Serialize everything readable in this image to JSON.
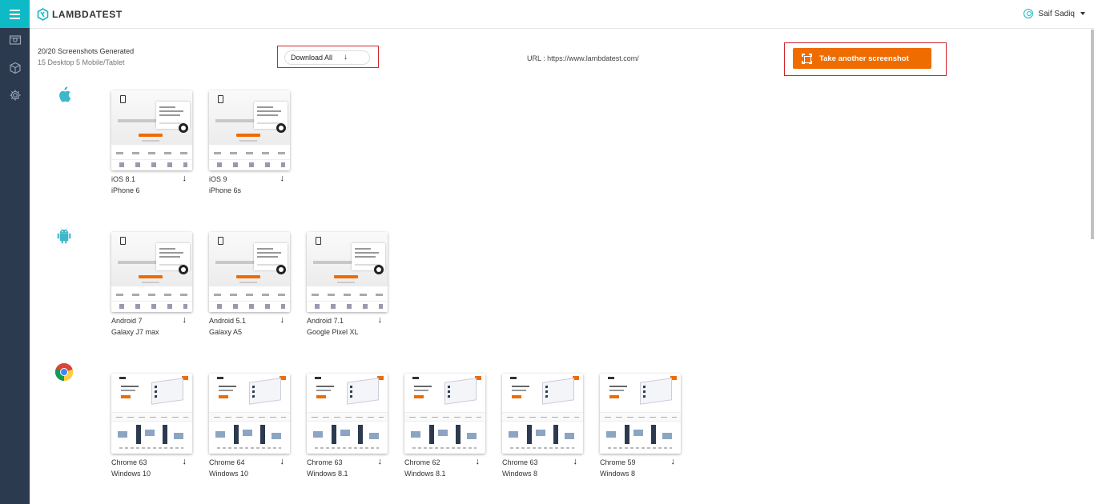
{
  "app": {
    "brand": "LAMBDATEST",
    "user_name": "Saif Sadiq"
  },
  "sidebar": {
    "items": [
      {
        "name": "menu",
        "icon": "menu-icon"
      },
      {
        "name": "screenshots",
        "icon": "screenshot-icon"
      },
      {
        "name": "box",
        "icon": "box-icon"
      },
      {
        "name": "settings",
        "icon": "gear-icon"
      }
    ]
  },
  "toolbar": {
    "generated": "20/20 Screenshots Generated",
    "breakdown": "15 Desktop 5 Mobile/Tablet",
    "download_all": "Download All",
    "download_arrow": "↓",
    "url": "URL : https://www.lambdatest.com/",
    "take_another": "Take another screenshot"
  },
  "colors": {
    "accent": "#0ebac5",
    "sidebar": "#2b3a4e",
    "cta": "#ef6c00",
    "highlight": "#d0262d"
  },
  "groups": [
    {
      "os": "ios",
      "icon": "apple-icon",
      "shots": [
        {
          "line1": "iOS 8.1",
          "line2": "iPhone 6"
        },
        {
          "line1": "iOS 9",
          "line2": "iPhone 6s"
        }
      ]
    },
    {
      "os": "android",
      "icon": "android-icon",
      "shots": [
        {
          "line1": "Android 7",
          "line2": "Galaxy J7 max"
        },
        {
          "line1": "Android 5.1",
          "line2": "Galaxy A5"
        },
        {
          "line1": "Android 7.1",
          "line2": "Google Pixel XL"
        }
      ]
    },
    {
      "os": "chrome",
      "icon": "chrome-icon",
      "shots": [
        {
          "line1": "Chrome 63",
          "line2": "Windows 10"
        },
        {
          "line1": "Chrome 64",
          "line2": "Windows 10"
        },
        {
          "line1": "Chrome 63",
          "line2": "Windows 8.1"
        },
        {
          "line1": "Chrome 62",
          "line2": "Windows 8.1"
        },
        {
          "line1": "Chrome 63",
          "line2": "Windows 8"
        },
        {
          "line1": "Chrome 59",
          "line2": "Windows 8"
        }
      ]
    }
  ]
}
